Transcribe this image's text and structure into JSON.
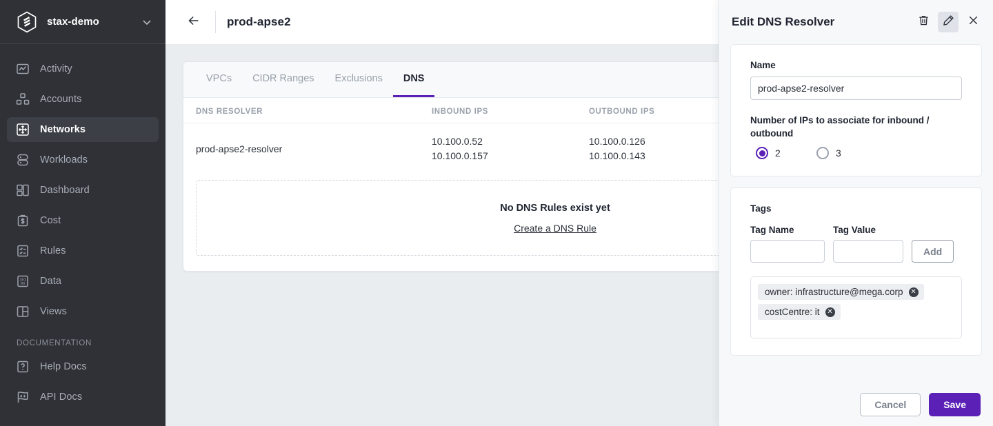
{
  "sidebar": {
    "brand": {
      "name": "stax-demo",
      "logo_icon": "stax-hex-logo",
      "caret_icon": "chevron-down-icon"
    },
    "items": [
      {
        "label": "Activity",
        "icon": "activity-chart-icon",
        "active": false
      },
      {
        "label": "Accounts",
        "icon": "accounts-blocks-icon",
        "active": false
      },
      {
        "label": "Networks",
        "icon": "networks-move-icon",
        "active": true
      },
      {
        "label": "Workloads",
        "icon": "workloads-server-icon",
        "active": false
      },
      {
        "label": "Dashboard",
        "icon": "dashboard-grid-icon",
        "active": false
      },
      {
        "label": "Cost",
        "icon": "cost-dollar-icon",
        "active": false
      },
      {
        "label": "Rules",
        "icon": "rules-checklist-icon",
        "active": false
      },
      {
        "label": "Data",
        "icon": "data-binary-icon",
        "active": false
      },
      {
        "label": "Views",
        "icon": "views-panel-icon",
        "active": false
      }
    ],
    "section_label": "DOCUMENTATION",
    "doc_items": [
      {
        "label": "Help Docs",
        "icon": "help-question-icon"
      },
      {
        "label": "API Docs",
        "icon": "api-code-flag-icon"
      }
    ]
  },
  "topbar": {
    "back_icon": "arrow-left-icon",
    "title": "prod-apse2"
  },
  "tabs": [
    {
      "label": "VPCs",
      "active": false
    },
    {
      "label": "CIDR Ranges",
      "active": false
    },
    {
      "label": "Exclusions",
      "active": false
    },
    {
      "label": "DNS",
      "active": true
    }
  ],
  "table": {
    "headers": [
      "DNS RESOLVER",
      "INBOUND IPS",
      "OUTBOUND IPS"
    ],
    "rows": [
      {
        "resolver": "prod-apse2-resolver",
        "inbound": [
          "10.100.0.52",
          "10.100.0.157"
        ],
        "outbound": [
          "10.100.0.126",
          "10.100.0.143"
        ]
      }
    ]
  },
  "empty_state": {
    "title": "No DNS Rules exist yet",
    "link": "Create a DNS Rule"
  },
  "panel": {
    "title": "Edit DNS Resolver",
    "actions": [
      {
        "icon": "trash-icon",
        "name": "delete-resolver-button",
        "active": false
      },
      {
        "icon": "pencil-icon",
        "name": "edit-resolver-button",
        "active": true
      },
      {
        "icon": "close-icon",
        "name": "close-panel-button",
        "active": false
      }
    ],
    "form": {
      "name_label": "Name",
      "name_value": "prod-apse2-resolver",
      "name_placeholder": "",
      "ip_count_label": "Number of IPs to associate for inbound / outbound",
      "ip_options": [
        {
          "label": "2",
          "selected": true
        },
        {
          "label": "3",
          "selected": false
        }
      ]
    },
    "tags": {
      "section_label": "Tags",
      "name_label": "Tag Name",
      "name_value": "",
      "name_placeholder": "",
      "value_label": "Tag Value",
      "value_value": "",
      "value_placeholder": "",
      "add_label": "Add",
      "chips": [
        {
          "text": "owner: infrastructure@mega.corp",
          "remove_icon": "chip-remove-icon"
        },
        {
          "text": "costCentre: it",
          "remove_icon": "chip-remove-icon"
        }
      ]
    },
    "footer": {
      "cancel_label": "Cancel",
      "save_label": "Save"
    }
  },
  "colors": {
    "accent_purple": "#5b21b6",
    "sidebar_bg": "#2f3136",
    "canvas_bg": "#e9edf0",
    "panel_bg": "#f7f8fa"
  }
}
